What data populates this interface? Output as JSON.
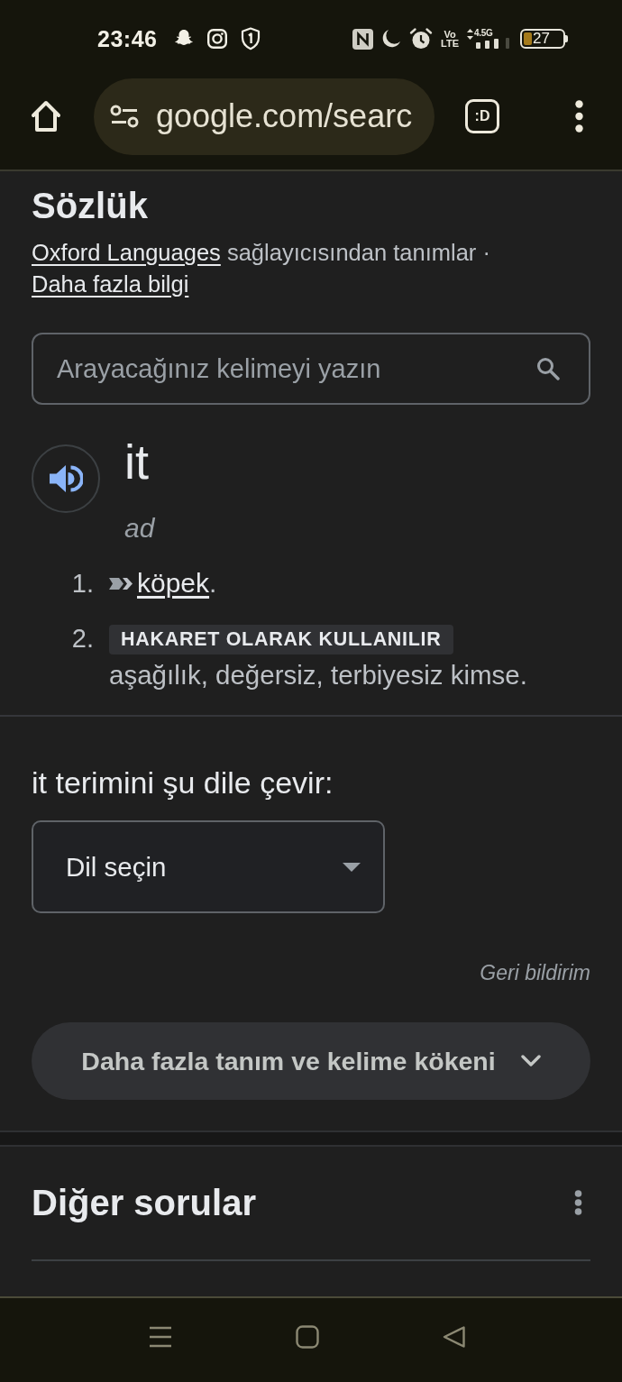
{
  "status_bar": {
    "time": "23:46",
    "network_mode": "Vo LTE",
    "network_type": "4.5G",
    "battery": "27"
  },
  "toolbar": {
    "url": "google.com/searc",
    "tab_count": ":D"
  },
  "dictionary": {
    "title": "Sözlük",
    "attribution": {
      "source_link": "Oxford Languages",
      "text": "sağlayıcısından tanımlar ·",
      "more_link": "Daha fazla bilgi"
    },
    "search": {
      "placeholder": "Arayacağınız kelimeyi yazın"
    },
    "entry": {
      "word": "it",
      "part_of_speech": "ad",
      "senses": [
        {
          "number": "1.",
          "kind": "synonym",
          "link": "köpek",
          "suffix": "."
        },
        {
          "number": "2.",
          "kind": "labeled",
          "label": "HAKARET OLARAK KULLANILIR",
          "definition": "aşağılık, değersiz, terbiyesiz kimse."
        }
      ]
    },
    "translate": {
      "prompt": "it terimini şu dile çevir:",
      "language_select": {
        "label": "Dil seçin"
      }
    },
    "feedback": "Geri bildirim",
    "more_button": {
      "label": "Daha fazla tanım ve kelime kökeni",
      "expanded": false
    }
  },
  "related_questions": {
    "title": "Diğer sorular"
  }
}
